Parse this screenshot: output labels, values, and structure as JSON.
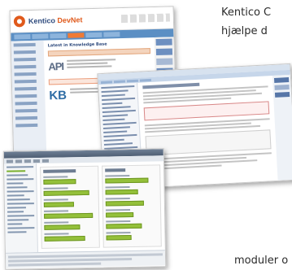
{
  "captions": {
    "top_line1": "Kentico C",
    "top_line2": "hjælpe d",
    "bottom": "moduler o"
  },
  "shot1": {
    "brand_main": "Kentico",
    "brand_accent": "DevNet",
    "article_title": "Latest in Knowledge Base",
    "icon_api": "API",
    "icon_kb": "KB"
  },
  "colors": {
    "kentico_orange": "#e05a1c",
    "kentico_blue": "#2e4a7d",
    "ui_green": "#94c03a"
  }
}
